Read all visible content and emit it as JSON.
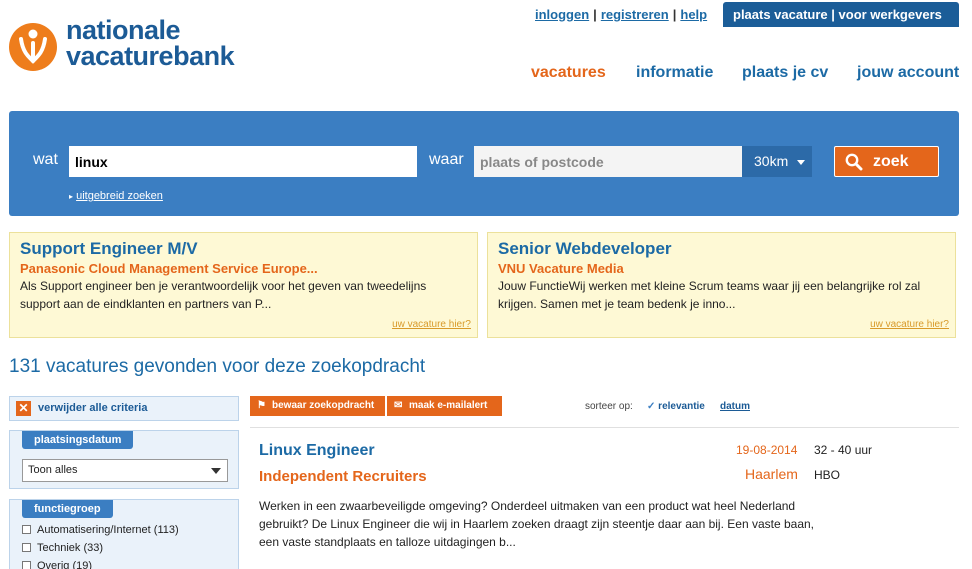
{
  "header": {
    "logo_line1": "nationale",
    "logo_line2": "vacaturebank",
    "top_links": [
      "inloggen",
      "registreren",
      "help"
    ],
    "employer_button": "plaats vacature | voor werkgevers",
    "nav": [
      "vacatures",
      "informatie",
      "plaats je cv",
      "jouw account"
    ],
    "active_nav": "vacatures"
  },
  "search": {
    "what_label": "wat",
    "what_value": "linux",
    "where_label": "waar",
    "where_placeholder": "plaats of postcode",
    "radius": "30km",
    "submit_label": "zoek",
    "advanced_link": "uitgebreid zoeken"
  },
  "featured": [
    {
      "title": "Support Engineer M/V",
      "company": "Panasonic Cloud Management Service Europe...",
      "description": "Als Support engineer ben je verantwoordelijk voor het geven van tweedelijns support aan de eindklanten en partners van P...",
      "link": "uw vacature hier?"
    },
    {
      "title": "Senior Webdeveloper",
      "company": "VNU Vacature Media",
      "description": "Jouw FunctieWij werken met kleine Scrum teams waar jij een belangrijke rol zal krijgen. Samen met je team bedenk je inno...",
      "link": "uw vacature hier?"
    }
  ],
  "results_summary": "131 vacatures gevonden voor deze zoekopdracht",
  "sidebar": {
    "remove_criteria": "verwijder alle criteria",
    "date_filter": {
      "heading": "plaatsingsdatum",
      "selected": "Toon alles"
    },
    "function_filter": {
      "heading": "functiegroep",
      "options": [
        "Automatisering/Internet (113)",
        "Techniek (33)",
        "Overig (19)"
      ]
    }
  },
  "toolbar": {
    "save_search": "bewaar zoekopdracht",
    "email_alert": "maak e-mailalert",
    "sort_label": "sorteer op:",
    "sort_relevance": "relevantie",
    "sort_date": "datum"
  },
  "results": [
    {
      "title": "Linux Engineer",
      "company": "Independent Recruiters",
      "date": "19-08-2014",
      "hours": "32 - 40 uur",
      "city": "Haarlem",
      "education": "HBO",
      "description": "Werken in een zwaarbeveiligde omgeving? Onderdeel uitmaken van een product wat heel Nederland gebruikt? De Linux Engineer die wij in Haarlem zoeken draagt zijn steentje daar aan bij. Een vaste baan, een vaste standplaats en talloze uitdagingen b..."
    }
  ],
  "colors": {
    "brand_blue": "#1c6aa5",
    "search_bg": "#3b7ec2",
    "accent_orange": "#e4661b",
    "featured_bg": "#fef9d5"
  }
}
